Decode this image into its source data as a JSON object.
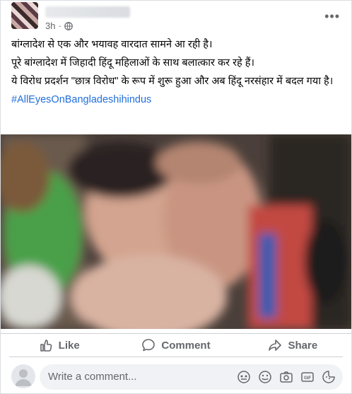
{
  "post": {
    "time": "3h",
    "privacy_icon": "globe-icon",
    "lines": [
      "बांग्लादेश से एक और भयावह वारदात सामने आ रही है।",
      "पूरे बांग्लादेश में जिहादी हिंदू महिलाओं के साथ बलात्कार कर रहे हैं।",
      "ये विरोध प्रदर्शन \"छात्र विरोध\" के रूप में शुरू हुआ और अब हिंदू नरसंहार में बदल गया है।"
    ],
    "hashtag": "#AllEyesOnBangladeshihindus"
  },
  "actions": {
    "like": "Like",
    "comment": "Comment",
    "share": "Share"
  },
  "comment_box": {
    "placeholder": "Write a comment..."
  },
  "colors": {
    "link": "#216fdb",
    "muted": "#65676b",
    "divider": "#ced0d4"
  }
}
